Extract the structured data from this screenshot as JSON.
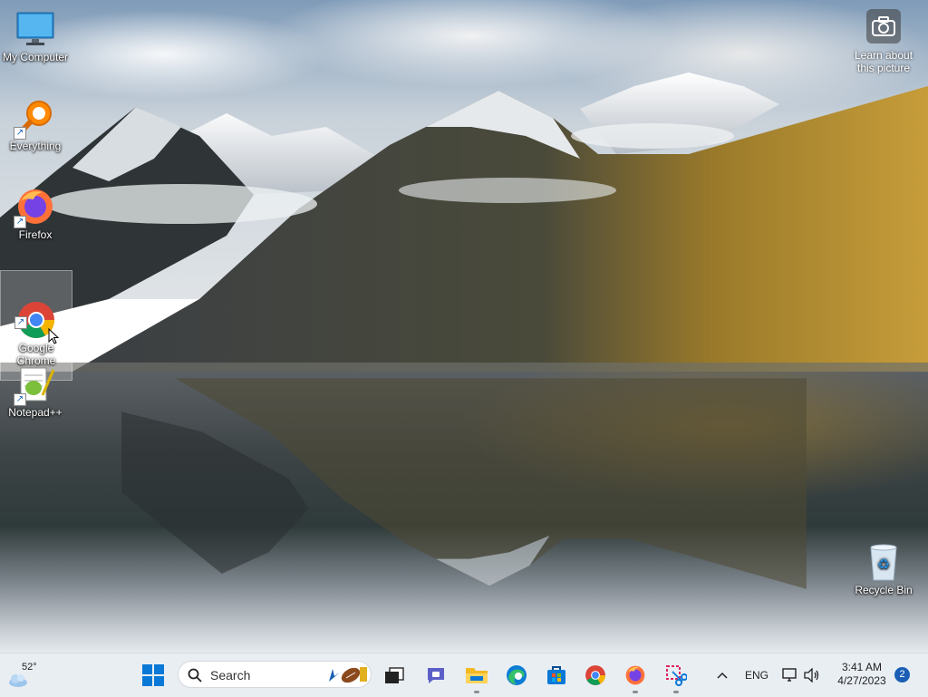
{
  "desktop": {
    "icons": [
      {
        "label": "My Computer",
        "icon": "monitor-icon"
      },
      {
        "label": "Everything",
        "icon": "magnifier-icon"
      },
      {
        "label": "Firefox",
        "icon": "firefox-icon"
      },
      {
        "label": "Google\nChrome",
        "icon": "chrome-icon"
      },
      {
        "label": "Notepad++",
        "icon": "notepadpp-icon"
      },
      {
        "label": "Recycle Bin",
        "icon": "recycle-bin-icon"
      }
    ],
    "learn_about": "Learn about\nthis picture"
  },
  "taskbar": {
    "weather": {
      "temp": "52°",
      "icon": "cloudy-weather-icon"
    },
    "search": {
      "placeholder": "Search"
    },
    "apps": [
      {
        "name": "start",
        "icon": "windows-logo-icon"
      },
      {
        "name": "task-view",
        "icon": "task-view-icon"
      },
      {
        "name": "chat",
        "icon": "teams-chat-icon"
      },
      {
        "name": "file-explorer",
        "icon": "folder-icon"
      },
      {
        "name": "edge",
        "icon": "edge-icon"
      },
      {
        "name": "store",
        "icon": "store-icon"
      },
      {
        "name": "chrome",
        "icon": "chrome-icon"
      },
      {
        "name": "firefox",
        "icon": "firefox-icon"
      },
      {
        "name": "snipping-tool",
        "icon": "snipping-tool-icon"
      }
    ],
    "tray": {
      "language": "ENG",
      "time": "3:41 AM",
      "date": "4/27/2023",
      "notifications": "2"
    }
  }
}
